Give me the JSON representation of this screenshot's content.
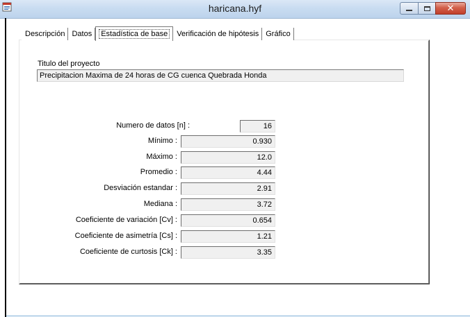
{
  "window": {
    "title": "haricana.hyf",
    "icon": "app-document-icon",
    "controls": [
      "minimize-icon",
      "maximize-icon",
      "close-icon"
    ]
  },
  "tabs": [
    {
      "label": "Descripción",
      "active": false
    },
    {
      "label": "Datos",
      "active": false
    },
    {
      "label": "Estadística de base",
      "active": true
    },
    {
      "label": "Verificación de hipótesis",
      "active": false
    },
    {
      "label": "Gráfico",
      "active": false
    }
  ],
  "project": {
    "label": "Titulo del proyecto",
    "value": "Precipitacion Maxima de 24 horas de CG cuenca Quebrada Honda"
  },
  "stats": [
    {
      "label": "Numero de datos [n]  :",
      "value": "16"
    },
    {
      "label": "Mínimo :",
      "value": "0.930"
    },
    {
      "label": "Máximo :",
      "value": "12.0"
    },
    {
      "label": "Promedio :",
      "value": "4.44"
    },
    {
      "label": "Desviación estandar :",
      "value": "2.91"
    },
    {
      "label": "Mediana :",
      "value": "3.72"
    },
    {
      "label": "Coeficiente de variación [Cv] :",
      "value": "0.654"
    },
    {
      "label": "Coeficiente de asimetría [Cs] :",
      "value": "1.21"
    },
    {
      "label": "Coeficiente de curtosis [Ck] :",
      "value": "3.35"
    }
  ]
}
